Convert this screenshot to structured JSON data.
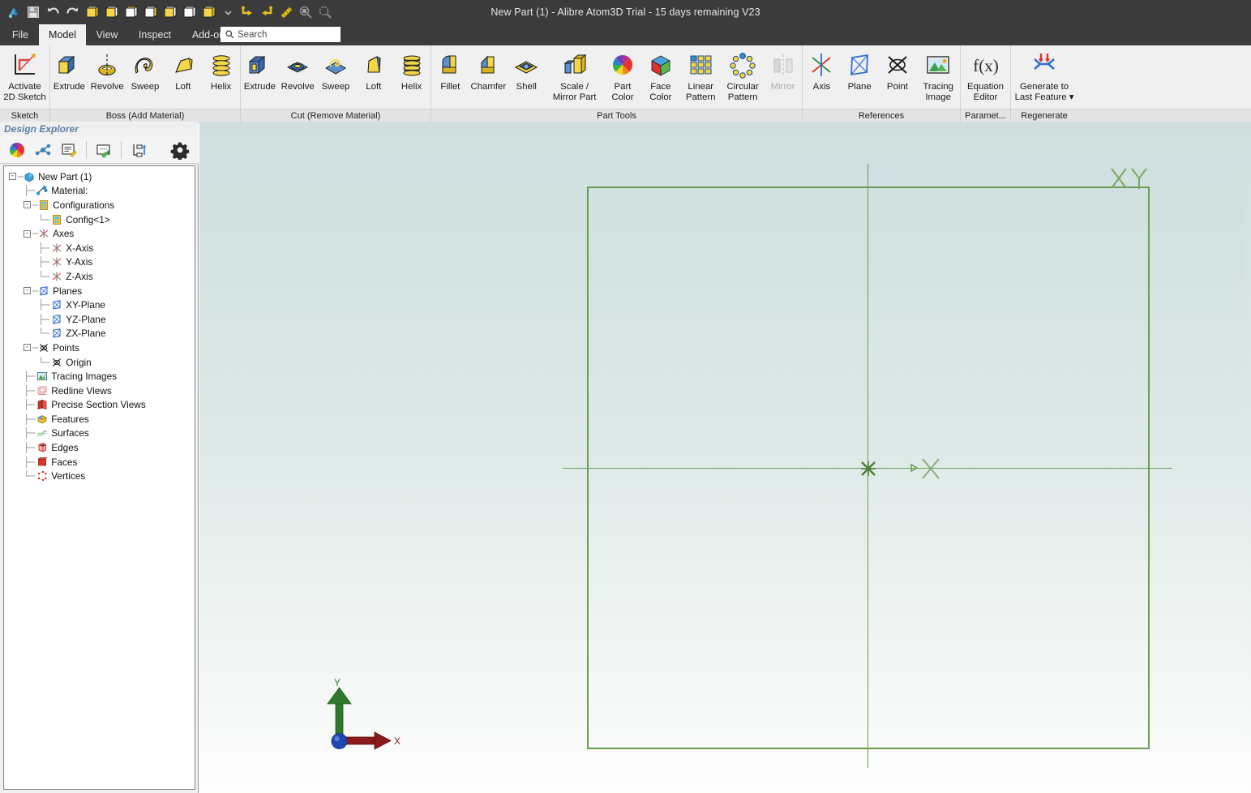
{
  "window": {
    "title": "New Part (1) - Alibre Atom3D  Trial - 15 days remaining V23"
  },
  "quick_access": {
    "items": [
      {
        "name": "alibre-logo-icon",
        "label": "Alibre"
      },
      {
        "name": "save-icon",
        "label": "Save"
      },
      {
        "name": "undo-icon",
        "label": "Undo"
      },
      {
        "name": "redo-icon",
        "label": "Redo"
      },
      {
        "name": "view-iso-icon",
        "label": "Isometric View"
      },
      {
        "name": "view-front-icon",
        "label": "Front View"
      },
      {
        "name": "view-top-icon",
        "label": "Top View"
      },
      {
        "name": "view-right-icon",
        "label": "Right View"
      },
      {
        "name": "view-back-icon",
        "label": "Back View"
      },
      {
        "name": "view-bottom-icon",
        "label": "Bottom View"
      },
      {
        "name": "view-shaded-icon",
        "label": "Shaded"
      },
      {
        "name": "view-dropdown-icon",
        "label": "More Views"
      },
      {
        "name": "rotate-ccw-icon",
        "label": "Rotate Left"
      },
      {
        "name": "rotate-cw-icon",
        "label": "Rotate Right"
      },
      {
        "name": "measure-icon",
        "label": "Measure"
      },
      {
        "name": "zoom-window-icon",
        "label": "Zoom Window"
      },
      {
        "name": "zoom-fit-icon",
        "label": "Zoom To Fit"
      }
    ]
  },
  "tabs": {
    "items": [
      {
        "label": "File",
        "active": false
      },
      {
        "label": "Model",
        "active": true
      },
      {
        "label": "View",
        "active": false
      },
      {
        "label": "Inspect",
        "active": false
      },
      {
        "label": "Add-on",
        "active": false
      }
    ]
  },
  "search": {
    "placeholder": "Search",
    "value": "",
    "icon": "search-icon"
  },
  "ribbon": {
    "groups": [
      {
        "caption": "Sketch",
        "buttons": [
          {
            "label": "Activate\n2D Sketch",
            "icon": "activate-2d-sketch-icon",
            "disabled": false
          }
        ]
      },
      {
        "caption": "Boss (Add Material)",
        "buttons": [
          {
            "label": "Extrude",
            "icon": "boss-extrude-icon",
            "disabled": false
          },
          {
            "label": "Revolve",
            "icon": "boss-revolve-icon",
            "disabled": false
          },
          {
            "label": "Sweep",
            "icon": "boss-sweep-icon",
            "disabled": false
          },
          {
            "label": "Loft",
            "icon": "boss-loft-icon",
            "disabled": false
          },
          {
            "label": "Helix",
            "icon": "boss-helix-icon",
            "disabled": false
          }
        ]
      },
      {
        "caption": "Cut (Remove Material)",
        "buttons": [
          {
            "label": "Extrude",
            "icon": "cut-extrude-icon",
            "disabled": false
          },
          {
            "label": "Revolve",
            "icon": "cut-revolve-icon",
            "disabled": false
          },
          {
            "label": "Sweep",
            "icon": "cut-sweep-icon",
            "disabled": false
          },
          {
            "label": "Loft",
            "icon": "cut-loft-icon",
            "disabled": false
          },
          {
            "label": "Helix",
            "icon": "cut-helix-icon",
            "disabled": false
          }
        ]
      },
      {
        "caption": "Part Tools",
        "buttons": [
          {
            "label": "Fillet",
            "icon": "fillet-icon",
            "disabled": false
          },
          {
            "label": "Chamfer",
            "icon": "chamfer-icon",
            "disabled": false
          },
          {
            "label": "Shell",
            "icon": "shell-icon",
            "disabled": false
          },
          {
            "label": "Scale /\nMirror Part",
            "icon": "scale-mirror-part-icon",
            "disabled": false
          },
          {
            "label": "Part Color",
            "icon": "part-color-icon",
            "disabled": false
          },
          {
            "label": "Face Color",
            "icon": "face-color-icon",
            "disabled": false
          },
          {
            "label": "Linear\nPattern",
            "icon": "linear-pattern-icon",
            "disabled": false
          },
          {
            "label": "Circular\nPattern",
            "icon": "circular-pattern-icon",
            "disabled": false
          },
          {
            "label": "Mirror",
            "icon": "mirror-icon",
            "disabled": true
          }
        ]
      },
      {
        "caption": "References",
        "buttons": [
          {
            "label": "Axis",
            "icon": "ref-axis-icon",
            "disabled": false
          },
          {
            "label": "Plane",
            "icon": "ref-plane-icon",
            "disabled": false
          },
          {
            "label": "Point",
            "icon": "ref-point-icon",
            "disabled": false
          },
          {
            "label": "Tracing\nImage",
            "icon": "tracing-image-icon",
            "disabled": false
          }
        ]
      },
      {
        "caption": "Paramet...",
        "buttons": [
          {
            "label": "Equation\nEditor",
            "icon": "equation-editor-icon",
            "disabled": false
          }
        ]
      },
      {
        "caption": "Regenerate",
        "buttons": [
          {
            "label": "Generate to\nLast Feature ▾",
            "icon": "generate-last-feature-icon",
            "disabled": false
          }
        ]
      }
    ]
  },
  "explorer": {
    "title": "Design Explorer",
    "toolbar": [
      {
        "name": "color-wheel-icon",
        "label": "Part Color"
      },
      {
        "name": "relations-icon",
        "label": "Show Relations"
      },
      {
        "name": "notes-icon",
        "label": "Design Notes"
      },
      {
        "name": "rename-icon",
        "label": "Rename"
      },
      {
        "name": "collapse-tree-icon",
        "label": "Collapse Tree"
      },
      {
        "name": "settings-gear-icon",
        "label": "Options"
      }
    ],
    "tree": [
      {
        "label": "New Part (1)",
        "depth": 0,
        "icon": "part-icon",
        "expander": "-"
      },
      {
        "label": "Material:",
        "depth": 1,
        "icon": "material-icon",
        "expander": ""
      },
      {
        "label": "Configurations",
        "depth": 1,
        "icon": "configurations-icon",
        "expander": "-"
      },
      {
        "label": "Config<1>",
        "depth": 2,
        "icon": "config-icon",
        "expander": ""
      },
      {
        "label": "Axes",
        "depth": 1,
        "icon": "axes-icon",
        "expander": "-"
      },
      {
        "label": "X-Axis",
        "depth": 2,
        "icon": "axis-icon",
        "expander": ""
      },
      {
        "label": "Y-Axis",
        "depth": 2,
        "icon": "axis-icon",
        "expander": ""
      },
      {
        "label": "Z-Axis",
        "depth": 2,
        "icon": "axis-icon",
        "expander": ""
      },
      {
        "label": "Planes",
        "depth": 1,
        "icon": "planes-icon",
        "expander": "-"
      },
      {
        "label": "XY-Plane",
        "depth": 2,
        "icon": "plane-icon",
        "expander": ""
      },
      {
        "label": "YZ-Plane",
        "depth": 2,
        "icon": "plane-icon",
        "expander": ""
      },
      {
        "label": "ZX-Plane",
        "depth": 2,
        "icon": "plane-icon",
        "expander": ""
      },
      {
        "label": "Points",
        "depth": 1,
        "icon": "points-icon",
        "expander": "-"
      },
      {
        "label": "Origin",
        "depth": 2,
        "icon": "point-icon",
        "expander": ""
      },
      {
        "label": "Tracing Images",
        "depth": 1,
        "icon": "tracing-images-icon",
        "expander": ""
      },
      {
        "label": "Redline Views",
        "depth": 1,
        "icon": "redline-views-icon",
        "expander": ""
      },
      {
        "label": "Precise Section Views",
        "depth": 1,
        "icon": "section-views-icon",
        "expander": ""
      },
      {
        "label": "Features",
        "depth": 1,
        "icon": "features-icon",
        "expander": ""
      },
      {
        "label": "Surfaces",
        "depth": 1,
        "icon": "surfaces-icon",
        "expander": ""
      },
      {
        "label": "Edges",
        "depth": 1,
        "icon": "edges-icon",
        "expander": ""
      },
      {
        "label": "Faces",
        "depth": 1,
        "icon": "faces-icon",
        "expander": ""
      },
      {
        "label": "Vertices",
        "depth": 1,
        "icon": "vertices-icon",
        "expander": ""
      }
    ]
  },
  "viewport": {
    "plane_label": "XY",
    "axis_x_label": "X",
    "axis_y_label": "Y",
    "origin_marker": "origin-icon",
    "cursor_marker": "sketch-cursor-icon"
  },
  "colors": {
    "titlebar": "#3b3b3b",
    "ribbon": "#f0f0f0",
    "accent_sketch_green": "#6a9e4f",
    "explorer_title": "#5a7fa8",
    "axis_x": "#8b1a1a",
    "axis_y": "#2d7a2d",
    "axis_origin": "#1c48b4"
  }
}
